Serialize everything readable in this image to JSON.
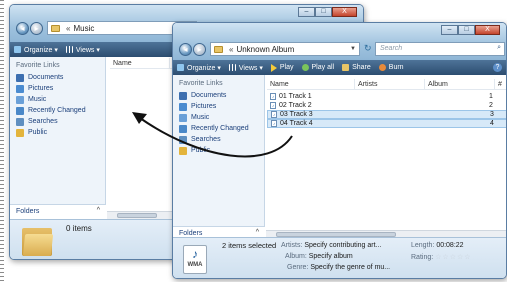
{
  "back_window": {
    "address": {
      "chevron": "«",
      "folder": "Music"
    },
    "caption": {
      "minimize": "–",
      "maximize": "□",
      "close": "X"
    },
    "toolbar": {
      "organize": "Organize ▾",
      "views": "Views ▾"
    },
    "nav_pane": {
      "header": "Favorite Links",
      "items": [
        {
          "label": "Documents",
          "icon": "documents-icon",
          "color": "#3d6fb0"
        },
        {
          "label": "Pictures",
          "icon": "pictures-icon",
          "color": "#4a8bd0"
        },
        {
          "label": "Music",
          "icon": "music-icon",
          "color": "#6aa0d8"
        },
        {
          "label": "Recently Changed",
          "icon": "recently-changed-icon",
          "color": "#4a88c8"
        },
        {
          "label": "Searches",
          "icon": "searches-icon",
          "color": "#5f8fc0"
        },
        {
          "label": "Public",
          "icon": "public-icon",
          "color": "#e3b43c"
        }
      ]
    },
    "folders_label": "Folders",
    "folders_caret": "^",
    "column_name": "Name",
    "status": "0 items"
  },
  "front_window": {
    "address": {
      "chevron": "«",
      "folder": "Unknown Album"
    },
    "caption": {
      "minimize": "–",
      "maximize": "□",
      "close": "X"
    },
    "search_placeholder": "Search",
    "toolbar": {
      "organize": "Organize ▾",
      "views": "Views ▾",
      "play": "Play",
      "play_all": "Play all",
      "share": "Share",
      "burn": "Burn",
      "help": "?"
    },
    "nav_pane": {
      "header": "Favorite Links",
      "items": [
        {
          "label": "Documents",
          "icon": "documents-icon",
          "color": "#3d6fb0"
        },
        {
          "label": "Pictures",
          "icon": "pictures-icon",
          "color": "#4a8bd0"
        },
        {
          "label": "Music",
          "icon": "music-icon",
          "color": "#6aa0d8"
        },
        {
          "label": "Recently Changed",
          "icon": "recently-changed-icon",
          "color": "#4a88c8"
        },
        {
          "label": "Searches",
          "icon": "searches-icon",
          "color": "#5f8fc0"
        },
        {
          "label": "Public",
          "icon": "public-icon",
          "color": "#e3b43c"
        }
      ]
    },
    "folders_label": "Folders",
    "folders_caret": "^",
    "columns": [
      "Name",
      "Artists",
      "Album",
      "#"
    ],
    "tracks": [
      {
        "name": "01 Track 1",
        "num": "1",
        "selected": false
      },
      {
        "name": "02 Track 2",
        "num": "2",
        "selected": false
      },
      {
        "name": "03 Track 3",
        "num": "3",
        "selected": true
      },
      {
        "name": "04 Track 4",
        "num": "4",
        "selected": true
      }
    ],
    "details": {
      "selected_count": "2 items selected",
      "artists_key": "Artists:",
      "artists_val": "Specify contributing art...",
      "length_key": "Length:",
      "length_val": "00:08:22",
      "album_key": "Album:",
      "album_val": "Specify album",
      "rating_key": "Rating:",
      "rating_stars": "☆☆☆☆☆",
      "genre_key": "Genre:",
      "genre_val": "Specify the genre of mu...",
      "file_type": "WMA"
    }
  }
}
